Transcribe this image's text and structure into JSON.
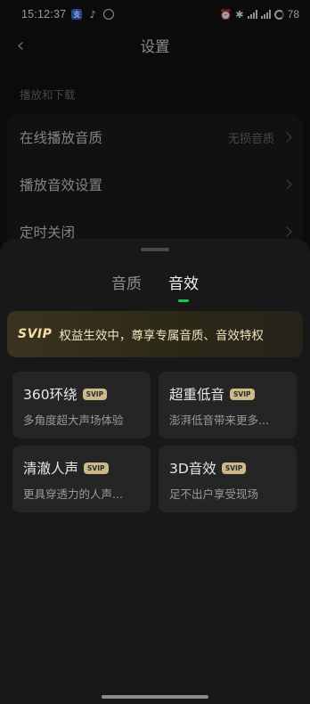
{
  "status_bar": {
    "time": "15:12:37",
    "app_icons": [
      "支",
      "tiktok-icon",
      "compass-icon"
    ],
    "battery": "78"
  },
  "header": {
    "title": "设置"
  },
  "section": {
    "label": "播放和下载"
  },
  "settings": {
    "rows": [
      {
        "label": "在线播放音质",
        "value": "无损音质"
      },
      {
        "label": "播放音效设置",
        "value": ""
      },
      {
        "label": "定时关闭",
        "value": ""
      }
    ]
  },
  "sheet": {
    "tabs": [
      {
        "label": "音质",
        "active": false
      },
      {
        "label": "音效",
        "active": true
      }
    ],
    "banner": {
      "logo": "SVIP",
      "text": "权益生效中，尊享专属音质、音效特权"
    },
    "effects": [
      {
        "title": "360环绕",
        "badge": "SVIP",
        "desc": "多角度超大声场体验"
      },
      {
        "title": "超重低音",
        "badge": "SVIP",
        "desc": "澎湃低音带来更多..."
      },
      {
        "title": "清澈人声",
        "badge": "SVIP",
        "desc": "更具穿透力的人声..."
      },
      {
        "title": "3D音效",
        "badge": "SVIP",
        "desc": "足不出户享受现场"
      }
    ]
  },
  "colors": {
    "accent": "#1ec25a",
    "svip_gold": "#f2dfa7"
  }
}
